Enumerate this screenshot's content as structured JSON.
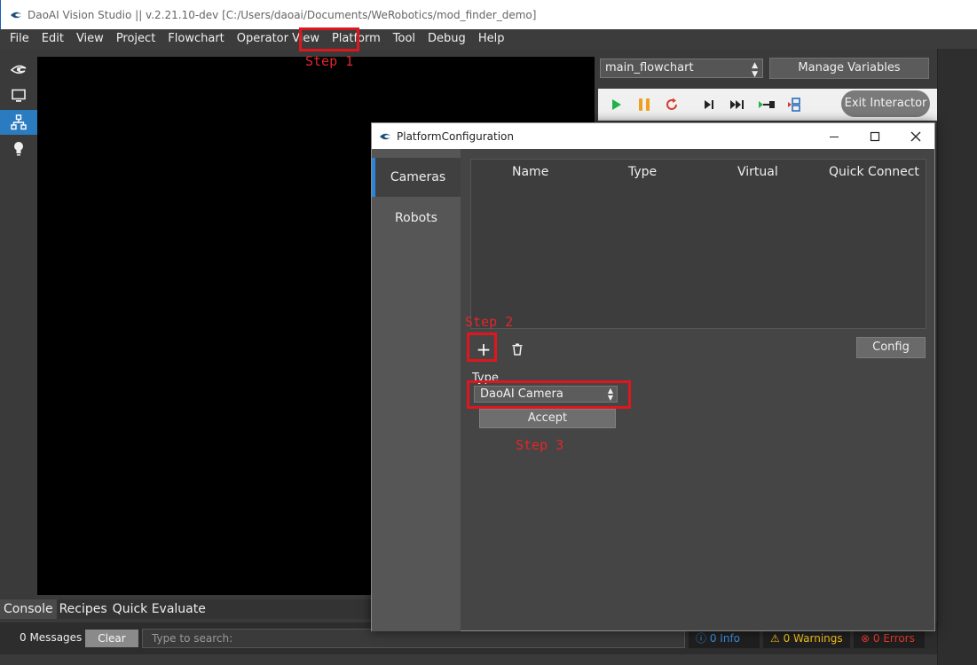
{
  "window": {
    "title": "DaoAI Vision Studio || v.2.21.10-dev   [C:/Users/daoai/Documents/WeRobotics/mod_finder_demo]"
  },
  "menu": [
    "File",
    "Edit",
    "View",
    "Project",
    "Flowchart",
    "Operator View",
    "Platform",
    "Tool",
    "Debug",
    "Help"
  ],
  "annotations": {
    "step1": "Step 1",
    "step2": "Step 2",
    "step3": "Step 3",
    "color": "#e0161e"
  },
  "flowchart": {
    "selected": "main_flowchart",
    "manage_variables": "Manage Variables",
    "exit_interactor": "Exit Interactor"
  },
  "console": {
    "tabs": [
      "Console",
      "Recipes",
      "Quick Evaluate"
    ],
    "messages": "0 Messages",
    "clear": "Clear",
    "search_placeholder": "Type to search:",
    "info": "0 Info",
    "warnings": "0 Warnings",
    "errors": "0 Errors"
  },
  "dialog": {
    "title": "PlatformConfiguration",
    "tabs": [
      "Cameras",
      "Robots"
    ],
    "columns": [
      "Name",
      "Type",
      "Virtual",
      "Quick Connect"
    ],
    "add": "+",
    "config": "Config",
    "type_label": "Type",
    "type_value": "DaoAI Camera",
    "accept": "Accept"
  },
  "colors": {
    "accent": "#2a86d8",
    "play": "#1fb34a",
    "pause": "#f0a020",
    "restart": "#d93a2b"
  }
}
